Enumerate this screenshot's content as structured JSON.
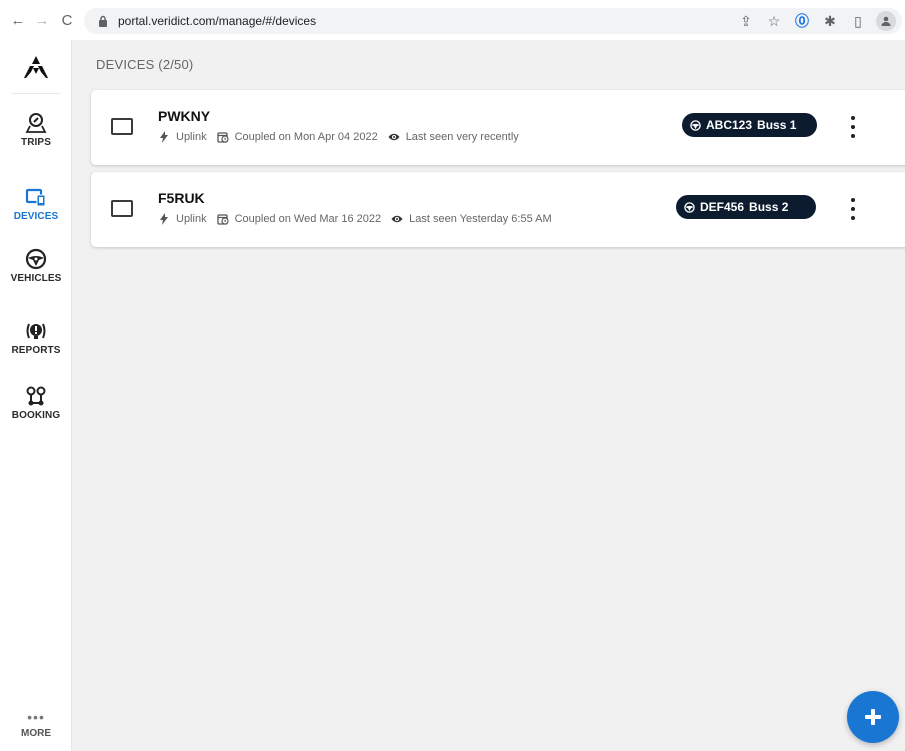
{
  "browser": {
    "back_glyph": "←",
    "forward_glyph": "→",
    "reload_glyph": "C",
    "url": "portal.veridict.com/manage/#/devices",
    "toolbar_icons": [
      "share-icon",
      "star-icon",
      "password-manager-icon",
      "extensions-icon",
      "sidebar-icon",
      "profile-icon"
    ],
    "star_glyph": "☆",
    "share_glyph": "⇪",
    "pm_glyph": "⓪",
    "ext_glyph": "✱",
    "sidebar_glyph": "▯"
  },
  "sidebar": {
    "items": [
      {
        "label": "TRIPS",
        "icon": "trips-icon",
        "active": false
      },
      {
        "label": "DEVICES",
        "icon": "devices-icon",
        "active": true
      },
      {
        "label": "VEHICLES",
        "icon": "steering-wheel-icon",
        "active": false
      },
      {
        "label": "REPORTS",
        "icon": "reports-icon",
        "active": false
      },
      {
        "label": "BOOKING",
        "icon": "booking-icon",
        "active": false
      }
    ],
    "more_dots": "•••",
    "more_label": "MORE"
  },
  "main": {
    "title": "DEVICES (2/50)",
    "devices": [
      {
        "name": "PWKNY",
        "connection": "Uplink",
        "coupled": "Coupled on Mon Apr 04 2022",
        "last_seen": "Last seen very recently",
        "plate": "ABC123",
        "vehicle": "Buss 1"
      },
      {
        "name": "F5RUK",
        "connection": "Uplink",
        "coupled": "Coupled on Wed Mar 16 2022",
        "last_seen": "Last seen Yesterday 6:55 AM",
        "plate": "DEF456",
        "vehicle": "Buss 2"
      }
    ]
  },
  "colors": {
    "accent": "#1976d2",
    "badge_bg": "#0d1b2e",
    "background": "#f1f1f1"
  }
}
